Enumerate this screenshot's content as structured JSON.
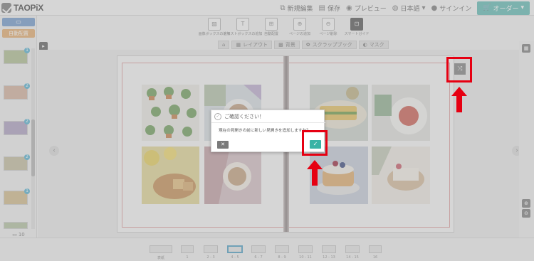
{
  "app": {
    "logo_text": "TAOPiX"
  },
  "topnav": {
    "items": [
      {
        "icon": "external-link-icon",
        "label": "新規編集"
      },
      {
        "icon": "save-icon",
        "label": "保存"
      },
      {
        "icon": "eye-icon",
        "label": "プレビュー"
      },
      {
        "icon": "globe-icon",
        "label": "日本語"
      },
      {
        "icon": "user-icon",
        "label": "サインイン"
      }
    ],
    "order_label": "オーダー"
  },
  "left": {
    "btn_top": "▭",
    "btn_bottom": "自動配置",
    "footer_count": "10"
  },
  "tools": [
    {
      "icon": "image-icon",
      "label": "画像ボックスの追加"
    },
    {
      "icon": "text-icon",
      "label": "テキストボックスの追加"
    },
    {
      "icon": "auto-layout-icon",
      "label": "自動配置"
    },
    {
      "icon": "page-add-icon",
      "label": "ページの追加"
    },
    {
      "icon": "page-delete-icon",
      "label": "ページ削除"
    },
    {
      "icon": "smart-guide-icon",
      "label": "スマートガイド"
    }
  ],
  "tabs": [
    {
      "icon": "home-icon",
      "label": ""
    },
    {
      "icon": "layout-icon",
      "label": "レイアウト"
    },
    {
      "icon": "background-icon",
      "label": "背景"
    },
    {
      "icon": "scrapbook-icon",
      "label": "スクラップブック"
    },
    {
      "icon": "mask-icon",
      "label": "マスク"
    }
  ],
  "dialog": {
    "title": "ご確認ください！",
    "message": "現在の見開きの前に新しい見開きを追加しますか？",
    "cancel_symbol": "✕",
    "confirm_symbol": "✓"
  },
  "filmstrip": [
    {
      "label": "表紙"
    },
    {
      "label": "1"
    },
    {
      "label": "2 - 3"
    },
    {
      "label": "4 - 5"
    },
    {
      "label": "6 - 7"
    },
    {
      "label": "8 - 9"
    },
    {
      "label": "10 - 11"
    },
    {
      "label": "12 - 13"
    },
    {
      "label": "14 - 15"
    },
    {
      "label": "16"
    }
  ],
  "colors": {
    "highlight": "#e60012",
    "confirm": "#3ab3a6",
    "order": "#5ab7b1"
  }
}
